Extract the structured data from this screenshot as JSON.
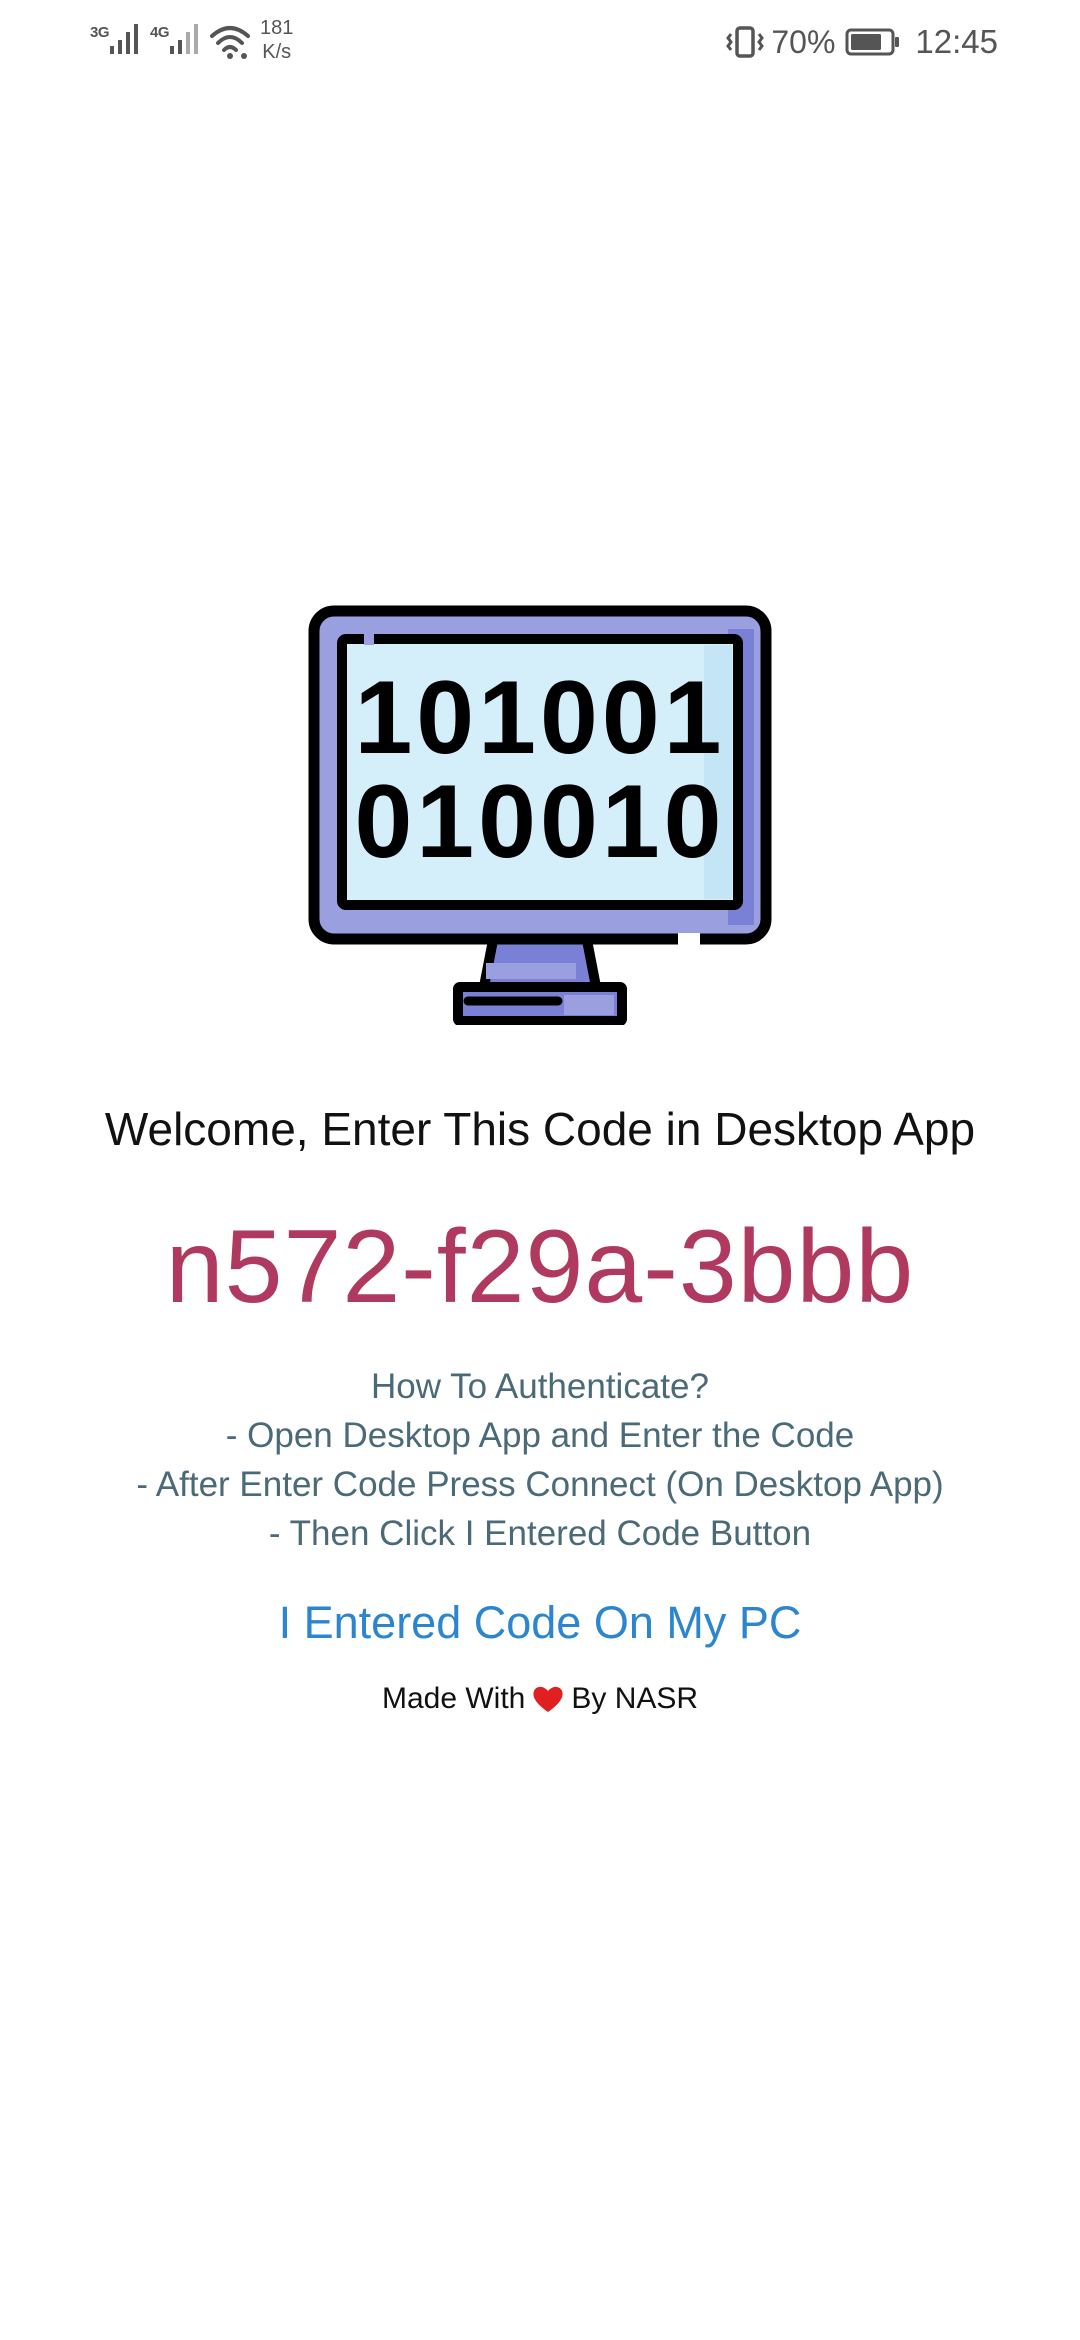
{
  "status_bar": {
    "network_1": "3G",
    "network_2": "4G",
    "speed_value": "181",
    "speed_unit": "K/s",
    "battery_percent": "70%",
    "time": "12:45",
    "icons": [
      "signal-icon",
      "wifi-icon",
      "vibrate-icon",
      "battery-icon"
    ]
  },
  "illustration": {
    "icon": "binary-monitor-icon",
    "binary_line_1": "101001",
    "binary_line_2": "010010"
  },
  "welcome_text": "Welcome, Enter This Code in Desktop App",
  "auth_code": "n572-f29a-3bbb",
  "instructions": {
    "heading": "How To Authenticate?",
    "step_1": "- Open Desktop App and Enter the Code",
    "step_2": "- After Enter Code Press Connect (On Desktop App)",
    "step_3": "- Then Click I Entered Code Button"
  },
  "entered_button_label": "I Entered Code On My PC",
  "credit": {
    "prefix": "Made With",
    "suffix": "By NASR",
    "icon": "heart-icon"
  },
  "colors": {
    "code": "#b03a5f",
    "instructions": "#4a6a78",
    "button": "#2b86cf",
    "heart": "#e02020",
    "monitor_frame": "#9a9fe0",
    "monitor_screen": "#d4eefa"
  }
}
